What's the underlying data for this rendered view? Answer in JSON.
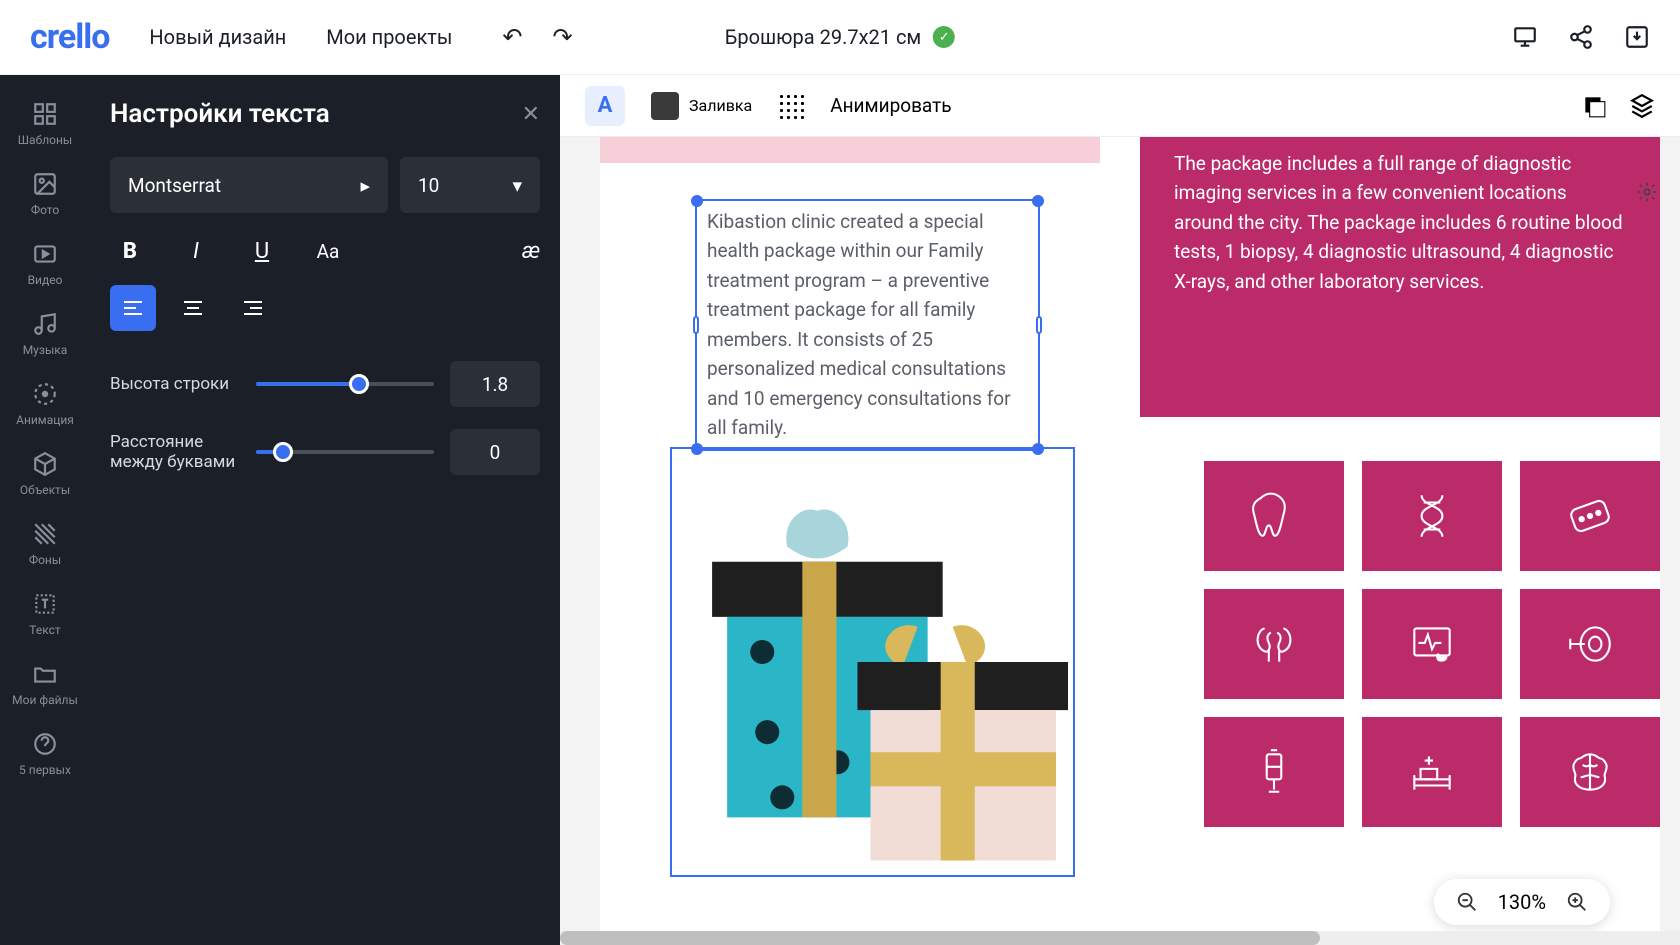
{
  "header": {
    "logo": "crello",
    "nav": {
      "new_design": "Новый дизайн",
      "my_projects": "Мои проекты"
    },
    "doc_title": "Брошюра 29.7x21  см"
  },
  "rail": {
    "templates": "Шаблоны",
    "photo": "Фото",
    "video": "Видео",
    "music": "Музыка",
    "animation": "Анимация",
    "objects": "Объекты",
    "backgrounds": "Фоны",
    "text": "Текст",
    "my_files": "Мои файлы",
    "top5": "5 первых"
  },
  "panel": {
    "title": "Настройки текста",
    "font_name": "Montserrat",
    "font_size": "10",
    "line_height_label": "Высота строки",
    "line_height_value": "1.8",
    "letter_spacing_label": "Расстояние между буквами",
    "letter_spacing_value": "0"
  },
  "context": {
    "fill_label": "Заливка",
    "animate_label": "Анимировать"
  },
  "canvas": {
    "selected_text": "Kibastion clinic created a special health package within our Family treatment program – a preventive treatment package for all family members. It consists of 25 personalized medical consultations and 10 emergency consultations for all family.",
    "magenta_text": "The package includes a  full range of diagnostic imaging services in a few convenient locations around the city. The package includes 6 routine blood tests, 1 biopsy, 4 diagnostic ultrasound, 4 diagnostic X-rays, and other laboratory services."
  },
  "zoom": {
    "value": "130%"
  }
}
